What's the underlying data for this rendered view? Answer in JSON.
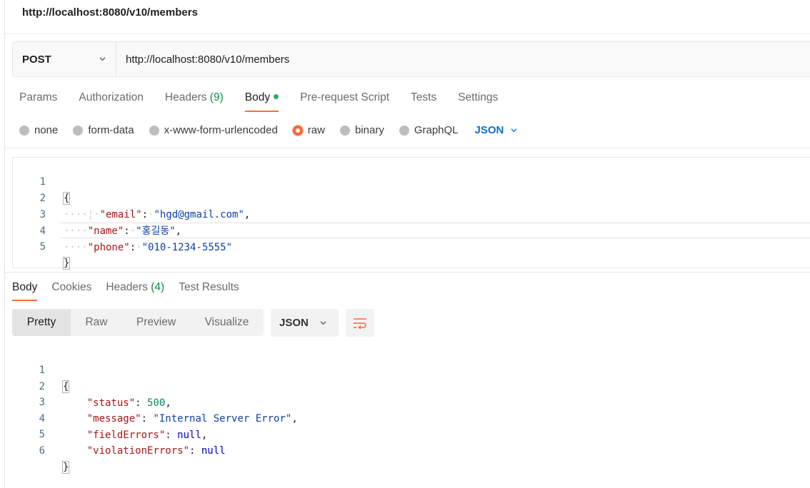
{
  "request": {
    "title": "http://localhost:8080/v10/members",
    "method": "POST",
    "url": "http://localhost:8080/v10/members"
  },
  "icons": {
    "method_dropdown": "chevron-down-icon",
    "body_active_dot": "green-dot-icon",
    "wrap": "wrap-lines-icon"
  },
  "colors": {
    "accent": "#ff6c37",
    "link_blue": "#0f6fc6",
    "count_green": "#0f8a4a"
  },
  "request_tabs": {
    "params": "Params",
    "authorization": "Authorization",
    "headers_label": "Headers",
    "headers_count": "(9)",
    "body": "Body",
    "pre_request": "Pre-request Script",
    "tests": "Tests",
    "settings": "Settings"
  },
  "body_options": {
    "none": "none",
    "form_data": "form-data",
    "urlencoded": "x-www-form-urlencoded",
    "raw": "raw",
    "binary": "binary",
    "graphql": "GraphQL",
    "format": "JSON",
    "selected": "raw"
  },
  "request_body": {
    "line_numbers": [
      "1",
      "2",
      "3",
      "4",
      "5"
    ],
    "open_brace": "{",
    "close_brace": "}",
    "email_key": "\"email\"",
    "email_value": "\"hgd@gmail.com\"",
    "name_key": "\"name\"",
    "name_value": "\"홍길동\"",
    "phone_key": "\"phone\"",
    "phone_value": "\"010-1234-5555\""
  },
  "response_tabs": {
    "body": "Body",
    "cookies": "Cookies",
    "headers_label": "Headers",
    "headers_count": "(4)",
    "test_results": "Test Results"
  },
  "response_view": {
    "pretty": "Pretty",
    "raw": "Raw",
    "preview": "Preview",
    "visualize": "Visualize",
    "format": "JSON"
  },
  "response_body": {
    "line_numbers": [
      "1",
      "2",
      "3",
      "4",
      "5",
      "6"
    ],
    "open_brace": "{",
    "close_brace": "}",
    "status_key": "\"status\"",
    "status_value": "500",
    "message_key": "\"message\"",
    "message_value": "\"Internal Server Error\"",
    "field_errors_key": "\"fieldErrors\"",
    "field_errors_value": "null",
    "violation_errors_key": "\"violationErrors\"",
    "violation_errors_value": "null"
  }
}
